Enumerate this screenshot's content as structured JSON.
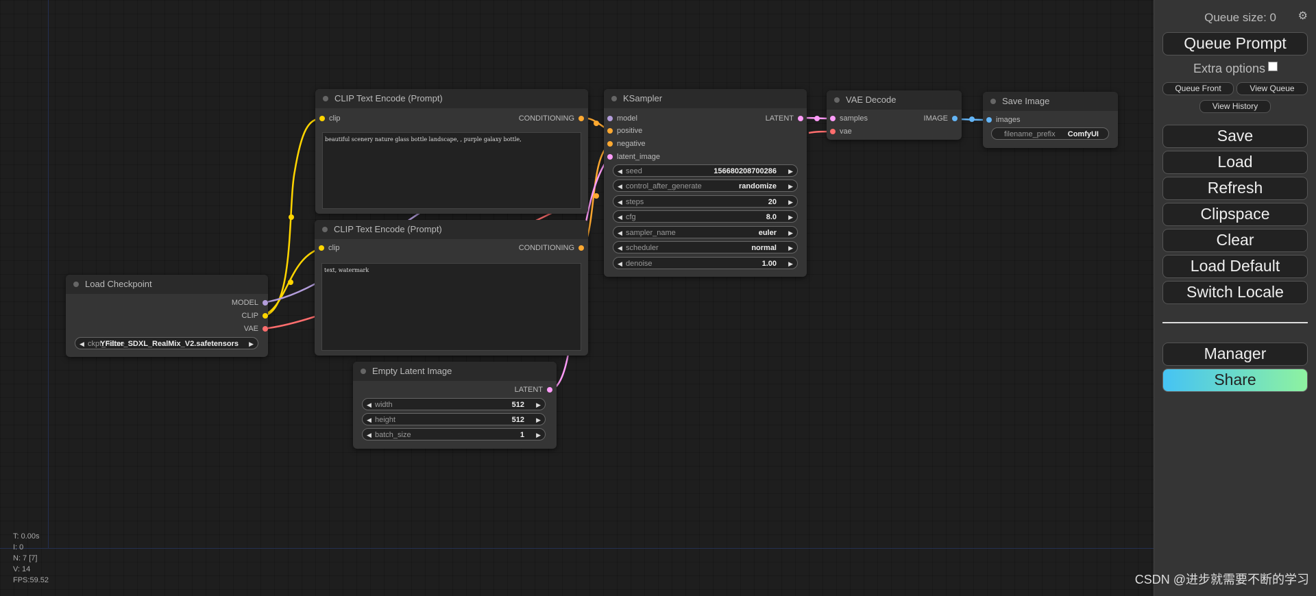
{
  "canvas": {
    "stats": [
      "T: 0.00s",
      "I: 0",
      "N: 7 [7]",
      "V: 14",
      "FPS:59.52"
    ]
  },
  "colors": {
    "clip": "#ffd500",
    "conditioning": "#ffa931",
    "model": "#b39ddb",
    "latent": "#ff9cf9",
    "vae": "#ff6e6e",
    "image": "#64b5f6",
    "share_gradient_start": "#45c3f4",
    "share_gradient_end": "#8ef2a0"
  },
  "nodes": {
    "load_checkpoint": {
      "title": "Load Checkpoint",
      "outputs": [
        "MODEL",
        "CLIP",
        "VAE"
      ],
      "widget_label": "ckpt_name",
      "widget_value": "YFilter_SDXL_RealMix_V2.safetensors"
    },
    "clip_pos": {
      "title": "CLIP Text Encode (Prompt)",
      "input": "clip",
      "output": "CONDITIONING",
      "text": "beautiful scenery nature glass bottle landscape, , purple galaxy bottle,"
    },
    "clip_neg": {
      "title": "CLIP Text Encode (Prompt)",
      "input": "clip",
      "output": "CONDITIONING",
      "text": "text, watermark"
    },
    "empty_latent": {
      "title": "Empty Latent Image",
      "output": "LATENT",
      "widgets": [
        {
          "label": "width",
          "value": "512"
        },
        {
          "label": "height",
          "value": "512"
        },
        {
          "label": "batch_size",
          "value": "1"
        }
      ]
    },
    "ksampler": {
      "title": "KSampler",
      "inputs": [
        "model",
        "positive",
        "negative",
        "latent_image"
      ],
      "output": "LATENT",
      "widgets": [
        {
          "label": "seed",
          "value": "156680208700286"
        },
        {
          "label": "control_after_generate",
          "value": "randomize"
        },
        {
          "label": "steps",
          "value": "20"
        },
        {
          "label": "cfg",
          "value": "8.0"
        },
        {
          "label": "sampler_name",
          "value": "euler"
        },
        {
          "label": "scheduler",
          "value": "normal"
        },
        {
          "label": "denoise",
          "value": "1.00"
        }
      ]
    },
    "vae_decode": {
      "title": "VAE Decode",
      "inputs": [
        "samples",
        "vae"
      ],
      "output": "IMAGE"
    },
    "save_image": {
      "title": "Save Image",
      "input": "images",
      "widget_label": "filename_prefix",
      "widget_value": "ComfyUI"
    }
  },
  "menu": {
    "queue_size": "Queue size: 0",
    "gear_icon": "gear-icon",
    "queue_prompt": "Queue Prompt",
    "extra_options": "Extra options",
    "queue_front": "Queue Front",
    "view_queue": "View Queue",
    "view_history": "View History",
    "buttons": [
      "Save",
      "Load",
      "Refresh",
      "Clipspace",
      "Clear",
      "Load Default",
      "Switch Locale"
    ],
    "manager": "Manager",
    "share": "Share"
  },
  "watermark": "CSDN @进步就需要不断的学习"
}
